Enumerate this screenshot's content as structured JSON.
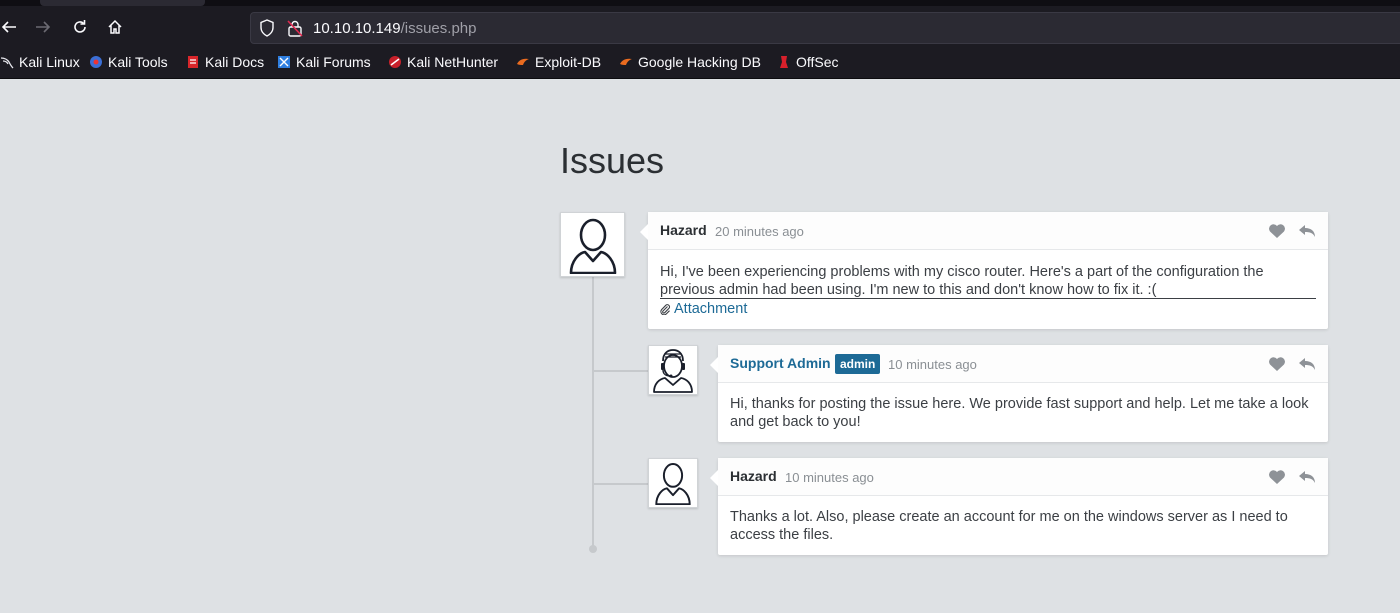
{
  "browser": {
    "url_host": "10.10.10.149",
    "url_path": "/issues.php",
    "bookmarks": [
      {
        "label": "Kali Linux",
        "icon": "kali-dragon-icon"
      },
      {
        "label": "Kali Tools",
        "icon": "kali-tools-icon"
      },
      {
        "label": "Kali Docs",
        "icon": "kali-docs-icon"
      },
      {
        "label": "Kali Forums",
        "icon": "kali-forums-icon"
      },
      {
        "label": "Kali NetHunter",
        "icon": "kali-nethunter-icon"
      },
      {
        "label": "Exploit-DB",
        "icon": "exploit-db-icon"
      },
      {
        "label": "Google Hacking DB",
        "icon": "ghdb-icon"
      },
      {
        "label": "OffSec",
        "icon": "offsec-icon"
      }
    ]
  },
  "page": {
    "title": "Issues"
  },
  "comments": [
    {
      "author": "Hazard",
      "time": "20 minutes ago",
      "avatar": "user-icon",
      "text": "Hi, I've been experiencing problems with my cisco router. Here's a part of the configuration the previous admin had been using. I'm new to this and don't know how to fix it. :(",
      "attachment": "Attachment"
    },
    {
      "author": "Support Admin",
      "badge": "admin",
      "time": "10 minutes ago",
      "avatar": "support-agent-icon",
      "text": "Hi, thanks for posting the issue here. We provide fast support and help. Let me take a look and get back to you!"
    },
    {
      "author": "Hazard",
      "time": "10 minutes ago",
      "avatar": "user-icon",
      "text": "Thanks a lot. Also, please create an account for me on the windows server as I need to access the files."
    }
  ],
  "colors": {
    "page_bg": "#dee1e4",
    "accent": "#1d6a96",
    "chrome_bg": "#1c1b22"
  }
}
